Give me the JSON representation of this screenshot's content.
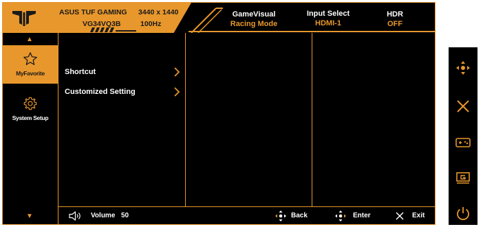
{
  "header": {
    "brand": "ASUS TUF GAMING",
    "model": "VG34VQ3B",
    "resolution": "3440 x 1440",
    "refresh": "100Hz",
    "status": [
      {
        "label": "GameVisual",
        "value": "Racing Mode"
      },
      {
        "label": "Input Select",
        "value": "HDMI-1"
      },
      {
        "label": "HDR",
        "value": "OFF"
      }
    ]
  },
  "nav": {
    "items": [
      {
        "label": "MyFavorite",
        "icon": "star-icon",
        "active": true
      },
      {
        "label": "System Setup",
        "icon": "gear-icon",
        "active": false
      }
    ]
  },
  "menu": {
    "items": [
      {
        "label": "Shortcut"
      },
      {
        "label": "Customized Setting"
      }
    ]
  },
  "footer": {
    "volume_label": "Volume",
    "volume_value": "50",
    "back_label": "Back",
    "enter_label": "Enter",
    "exit_label": "Exit"
  },
  "keys": [
    "five-way-joystick-icon",
    "close-icon",
    "gamepad-icon",
    "gameplus-icon",
    "power-icon"
  ],
  "colors": {
    "accent": "#e8972c",
    "background": "#000000",
    "text": "#ffffff"
  }
}
